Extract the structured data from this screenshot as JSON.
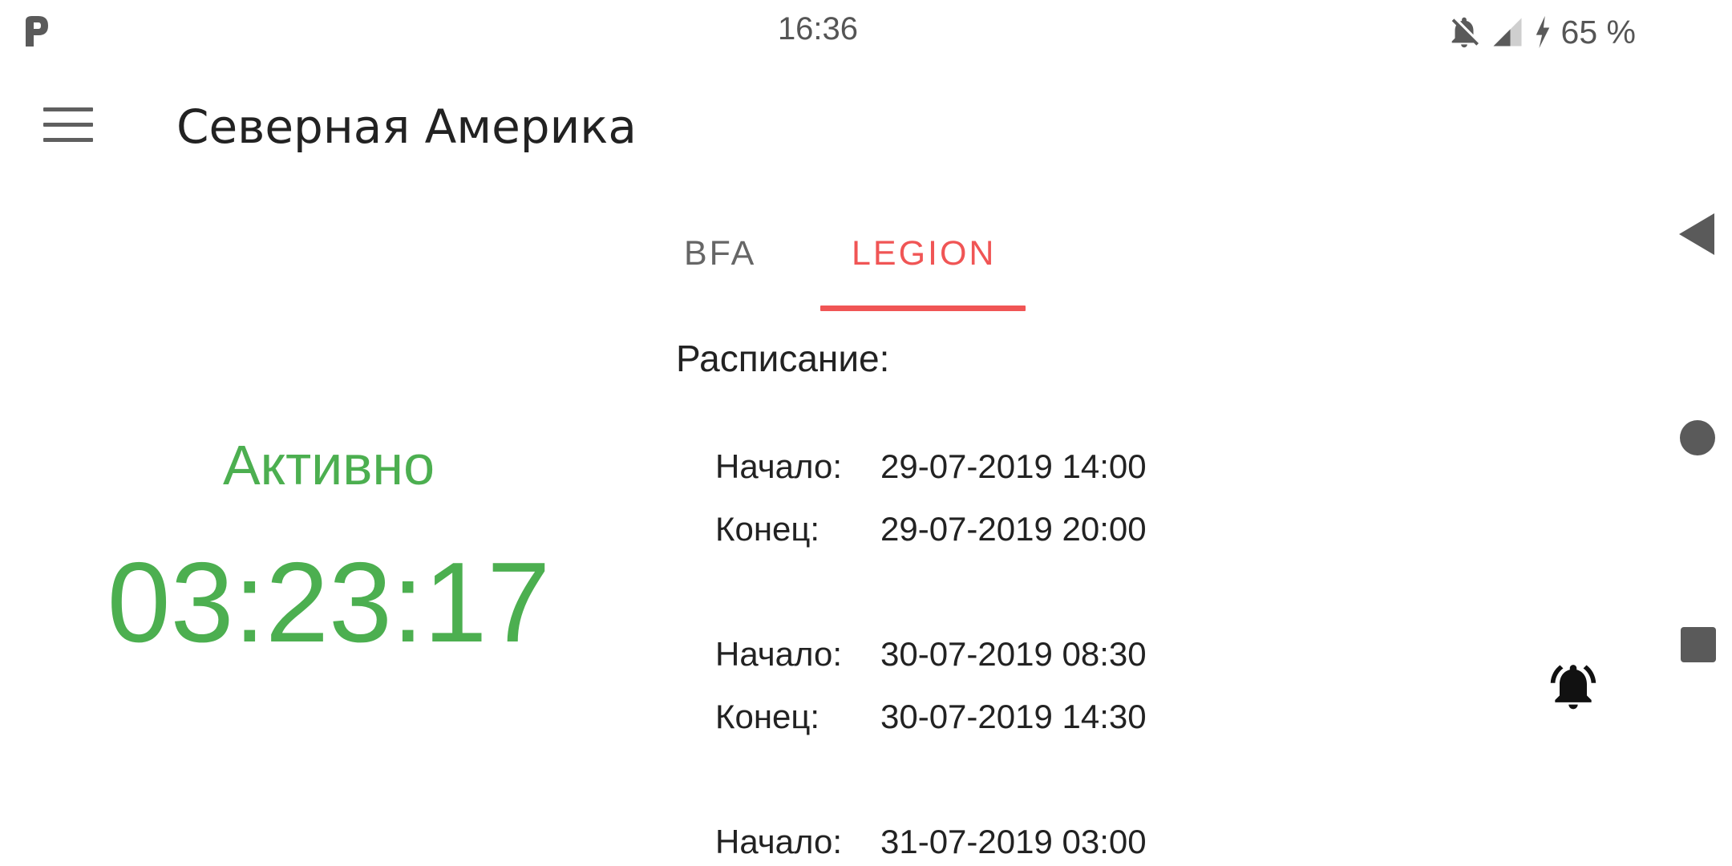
{
  "status_bar": {
    "time": "16:36",
    "battery": "65 %",
    "icons": [
      "app-p-icon",
      "bell-off-icon",
      "signal-icon",
      "charging-icon"
    ]
  },
  "app_bar": {
    "title": "Северная Америка",
    "menu_icon": "hamburger-menu-icon"
  },
  "tabs": [
    {
      "label": "BFA",
      "selected": false
    },
    {
      "label": "LEGION",
      "selected": true
    }
  ],
  "status": {
    "label": "Активно",
    "countdown": "03:23:17"
  },
  "schedule": {
    "title": "Расписание:",
    "entries": [
      {
        "start_label": "Начало:",
        "start": "29-07-2019 14:00",
        "end_label": "Конец:",
        "end": "29-07-2019 20:00"
      },
      {
        "start_label": "Начало:",
        "start": "30-07-2019 08:30",
        "end_label": "Конец:",
        "end": "30-07-2019 14:30"
      },
      {
        "start_label": "Начало:",
        "start": "31-07-2019 03:00"
      }
    ]
  },
  "alarm_icon": "bell-alarm-icon",
  "colors": {
    "accent": "#f05555",
    "active": "#4caf50",
    "text": "#222222",
    "muted": "#666666"
  }
}
